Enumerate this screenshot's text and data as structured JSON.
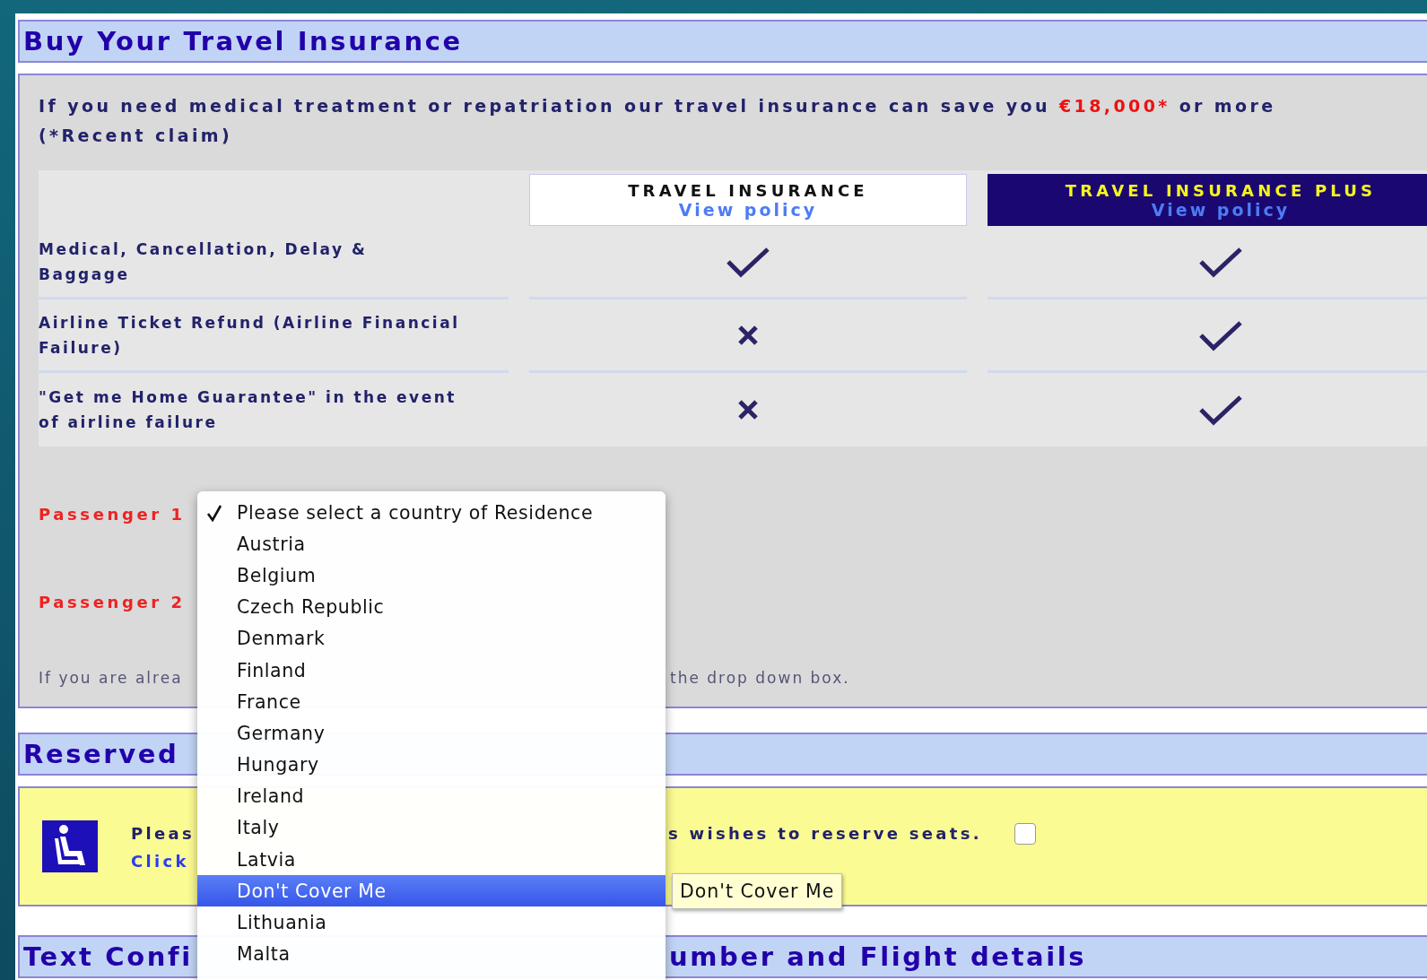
{
  "title": "Buy Your Travel Insurance",
  "intro": {
    "text_before": "If you need medical treatment or repatriation our travel insurance can save you",
    "highlight": "€18,000*",
    "text_after": "or more (*Recent claim)"
  },
  "plans": [
    {
      "name": "TRAVEL INSURANCE",
      "link": "View policy",
      "featured": false
    },
    {
      "name": "TRAVEL INSURANCE PLUS",
      "link": "View policy",
      "featured": true
    }
  ],
  "features": [
    {
      "label": "Medical, Cancellation, Delay & Baggage",
      "covered": [
        true,
        true
      ]
    },
    {
      "label": "Airline Ticket Refund (Airline Financial Failure)",
      "covered": [
        false,
        true
      ]
    },
    {
      "label": "\"Get me Home Guarantee\" in the event of airline failure",
      "covered": [
        false,
        true
      ]
    }
  ],
  "passengers": [
    {
      "label": "Passenger 1"
    },
    {
      "label": "Passenger 2"
    }
  ],
  "note": {
    "visible_start": "If you are alrea",
    "visible_end": "the drop down box."
  },
  "reserved_heading": "Reserved",
  "seats": {
    "text_start": "Pleas",
    "text_end": "s wishes to reserve seats.",
    "link": "Click",
    "checked": false
  },
  "text_heading": {
    "visible_start": "Text Confi",
    "visible_end": "umber and Flight details"
  },
  "dropdown": {
    "items": [
      {
        "label": "Please select a country of Residence",
        "checked": true,
        "selected": false
      },
      {
        "label": "Austria",
        "checked": false,
        "selected": false
      },
      {
        "label": "Belgium",
        "checked": false,
        "selected": false
      },
      {
        "label": "Czech Republic",
        "checked": false,
        "selected": false
      },
      {
        "label": "Denmark",
        "checked": false,
        "selected": false
      },
      {
        "label": "Finland",
        "checked": false,
        "selected": false
      },
      {
        "label": "France",
        "checked": false,
        "selected": false
      },
      {
        "label": "Germany",
        "checked": false,
        "selected": false
      },
      {
        "label": "Hungary",
        "checked": false,
        "selected": false
      },
      {
        "label": "Ireland",
        "checked": false,
        "selected": false
      },
      {
        "label": "Italy",
        "checked": false,
        "selected": false
      },
      {
        "label": "Latvia",
        "checked": false,
        "selected": false
      },
      {
        "label": "Don't Cover Me",
        "checked": false,
        "selected": true
      },
      {
        "label": "Lithuania",
        "checked": false,
        "selected": false
      },
      {
        "label": "Malta",
        "checked": false,
        "selected": false
      }
    ]
  },
  "tooltip": "Don't Cover Me"
}
